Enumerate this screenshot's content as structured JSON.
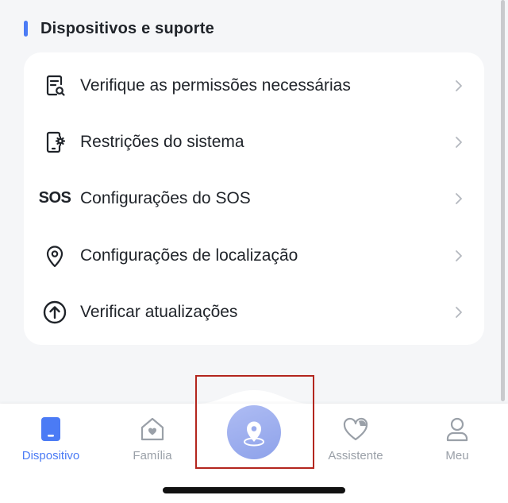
{
  "section": {
    "title": "Dispositivos e suporte"
  },
  "menu": {
    "items": [
      {
        "label": "Verifique as permissões necessárias",
        "icon": "document-search-icon"
      },
      {
        "label": "Restrições do sistema",
        "icon": "tablet-settings-icon"
      },
      {
        "label": "Configurações do SOS",
        "icon": "sos-icon",
        "icon_text": "SOS"
      },
      {
        "label": "Configurações de localização",
        "icon": "location-pin-icon"
      },
      {
        "label": "Verificar atualizações",
        "icon": "upload-arrow-icon"
      }
    ]
  },
  "tabbar": {
    "tabs": [
      {
        "label": "Dispositivo",
        "icon": "device-icon",
        "active": true
      },
      {
        "label": "Família",
        "icon": "family-home-icon",
        "active": false
      },
      {
        "label": "Assistente",
        "icon": "assistant-heart-icon",
        "active": false
      },
      {
        "label": "Meu",
        "icon": "profile-icon",
        "active": false
      }
    ],
    "center_button": {
      "icon": "location-pin-icon"
    }
  },
  "colors": {
    "accent": "#4b7bf5",
    "text_primary": "#1f2329",
    "text_muted": "#9aa0a8",
    "background": "#f5f6f8",
    "highlight": "#b3261e"
  }
}
